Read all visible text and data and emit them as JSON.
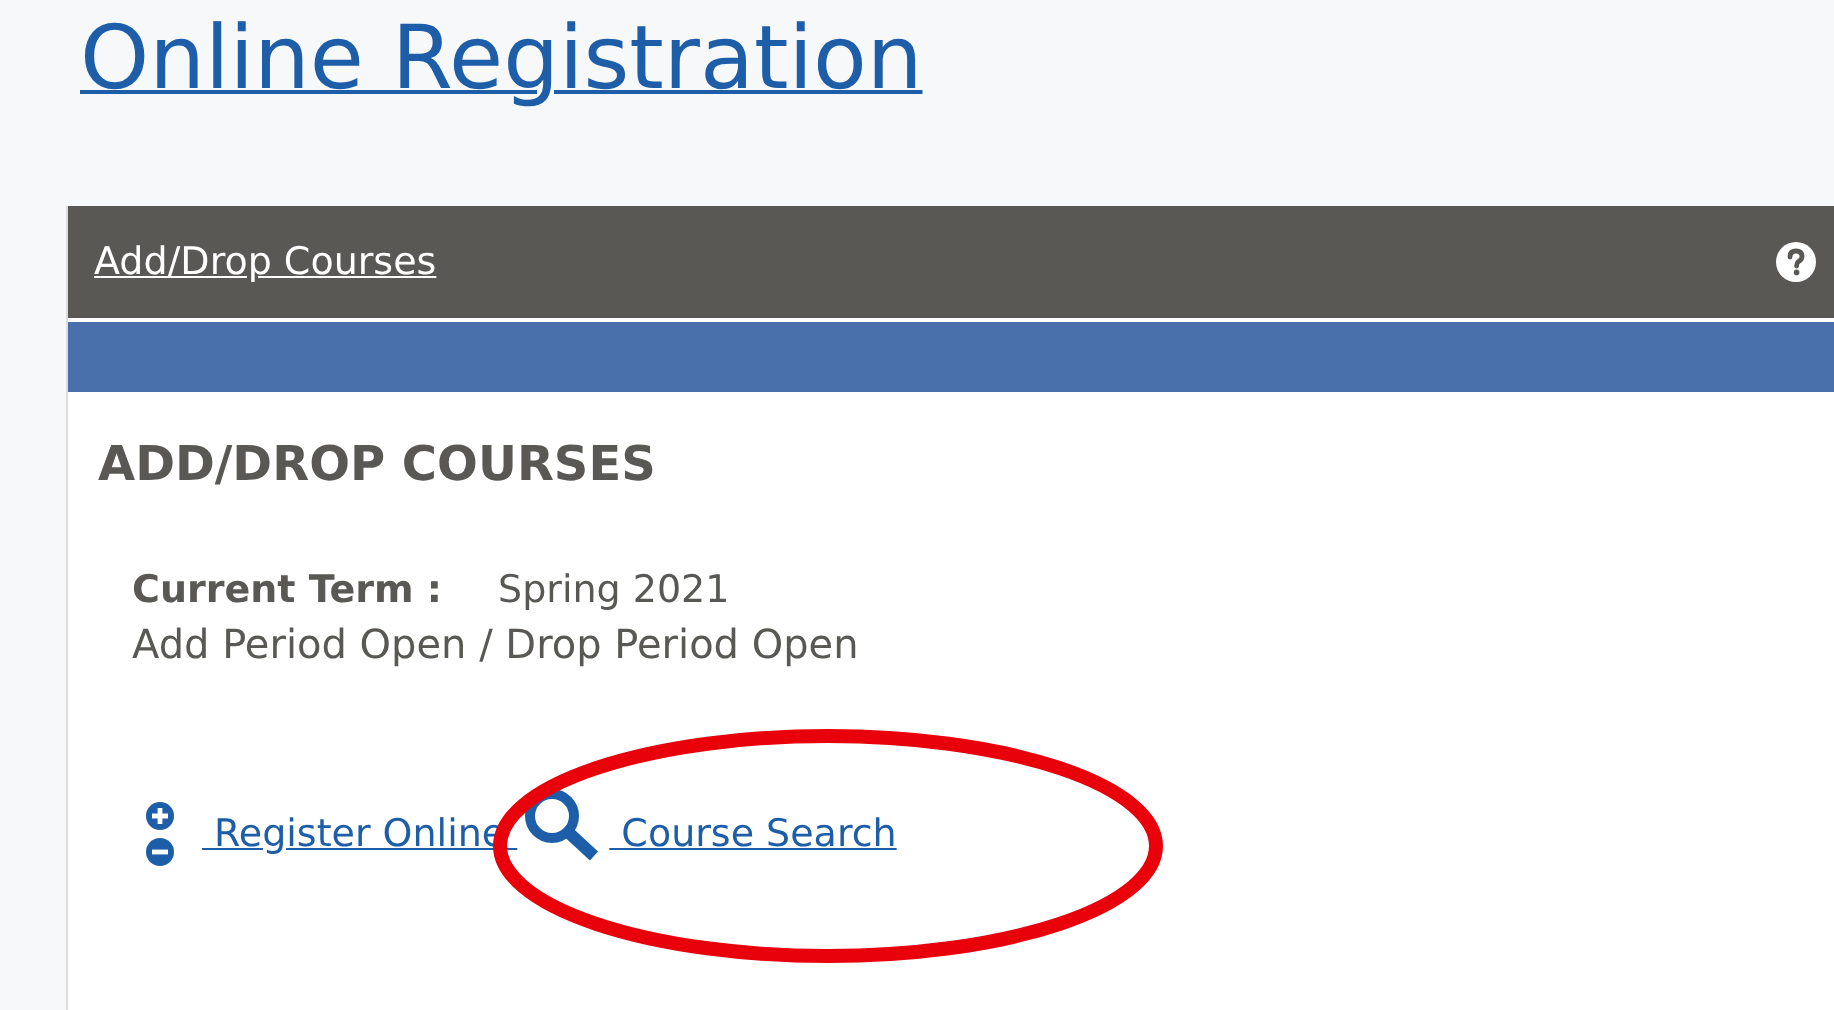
{
  "page_title": "Online Registration",
  "panel": {
    "header_link": "Add/Drop Courses",
    "heading": "ADD/DROP COURSES",
    "term_label": "Current Term :",
    "term_value": "Spring 2021",
    "status": "Add Period Open / Drop Period Open",
    "links": [
      {
        "kind": "register",
        "label": " Register Online "
      },
      {
        "kind": "search",
        "label": " Course Search"
      }
    ]
  },
  "annotation": {
    "kind": "ellipse",
    "color": "#e8000b"
  }
}
